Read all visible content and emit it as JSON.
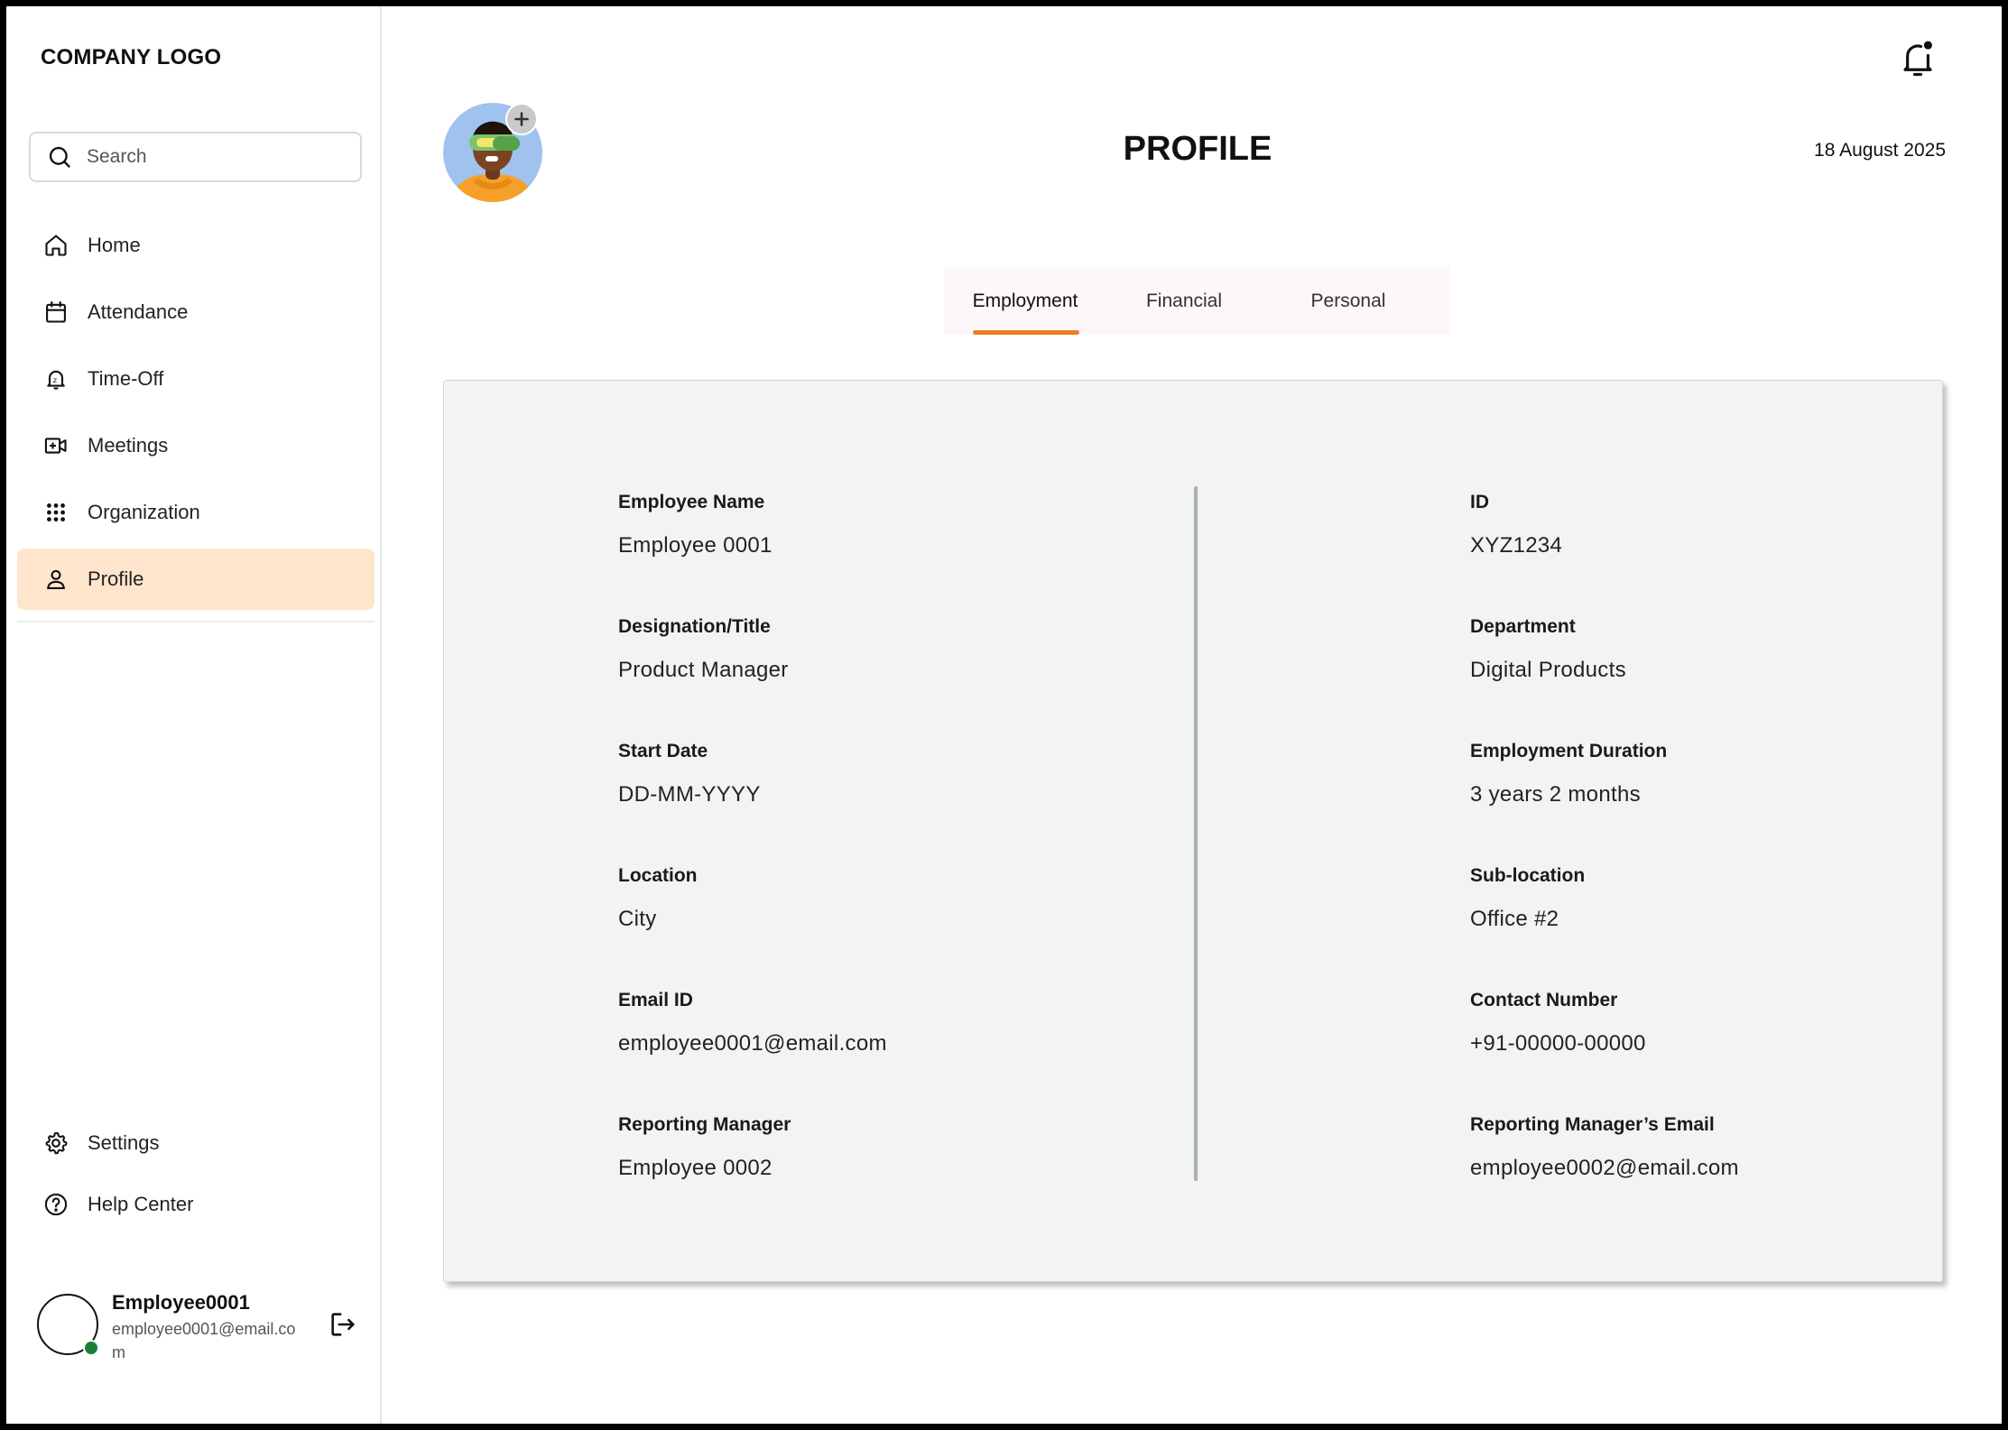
{
  "app": {
    "logo_text": "COMPANY LOGO"
  },
  "search": {
    "placeholder": "Search"
  },
  "sidebar": {
    "items": [
      {
        "label": "Home",
        "icon": "home-icon"
      },
      {
        "label": "Attendance",
        "icon": "calendar-icon"
      },
      {
        "label": "Time-Off",
        "icon": "bell-icon"
      },
      {
        "label": "Meetings",
        "icon": "video-add-icon"
      },
      {
        "label": "Organization",
        "icon": "grid-icon"
      },
      {
        "label": "Profile",
        "icon": "user-icon",
        "active": true
      }
    ],
    "bottom_items": [
      {
        "label": "Settings",
        "icon": "gear-icon"
      },
      {
        "label": "Help Center",
        "icon": "help-icon"
      }
    ],
    "active_color": "#ffe5cc"
  },
  "user": {
    "name": "Employee0001",
    "email": "employee0001@email.com",
    "status_color": "#1a7f37"
  },
  "header": {
    "title": "PROFILE",
    "date": "18 August 2025"
  },
  "tabs": [
    {
      "label": "Employment",
      "active": true
    },
    {
      "label": "Financial",
      "active": false
    },
    {
      "label": "Personal",
      "active": false
    }
  ],
  "accent_color": "#f07c22",
  "employment": {
    "left": [
      {
        "label": "Employee Name",
        "value": "Employee 0001"
      },
      {
        "label": "Designation/Title",
        "value": "Product Manager"
      },
      {
        "label": "Start Date",
        "value": "DD-MM-YYYY"
      },
      {
        "label": "Location",
        "value": "City"
      },
      {
        "label": "Email ID",
        "value": "employee0001@email.com"
      },
      {
        "label": "Reporting Manager",
        "value": "Employee 0002"
      }
    ],
    "right": [
      {
        "label": "ID",
        "value": "XYZ1234"
      },
      {
        "label": "Department",
        "value": "Digital Products"
      },
      {
        "label": "Employment Duration",
        "value": "3 years 2 months"
      },
      {
        "label": "Sub-location",
        "value": "Office #2"
      },
      {
        "label": "Contact Number",
        "value": "+91-00000-00000"
      },
      {
        "label": "Reporting Manager’s Email",
        "value": "employee0002@email.com"
      }
    ]
  }
}
